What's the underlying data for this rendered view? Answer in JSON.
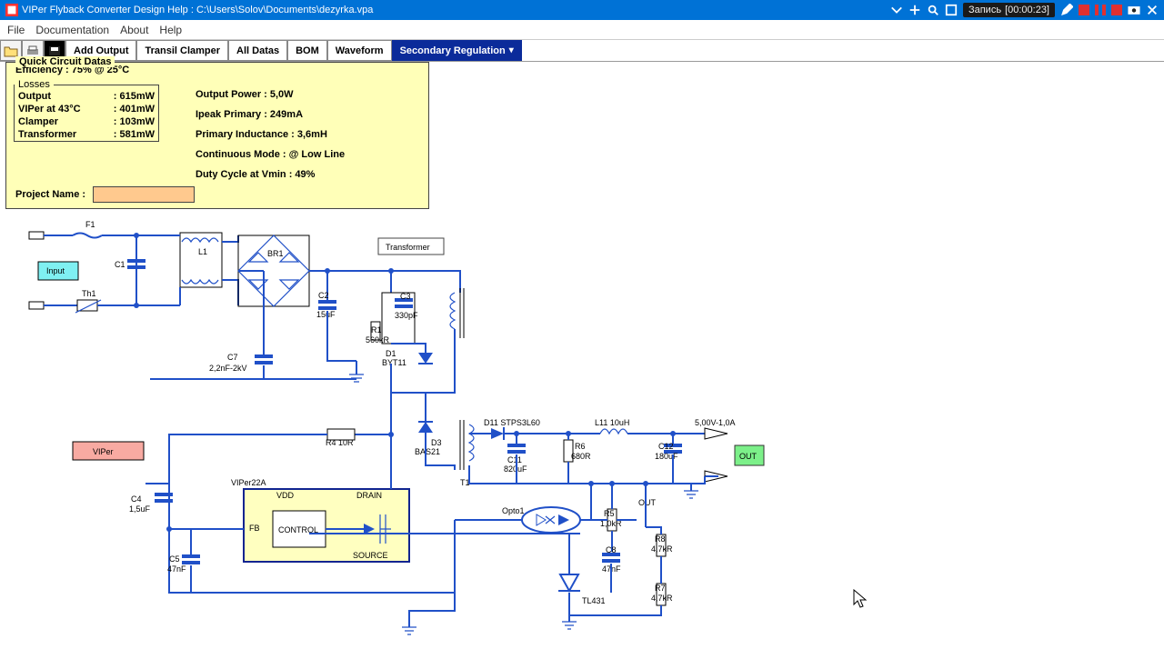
{
  "window": {
    "title": "VIPer Flyback Converter Design Help :  C:\\Users\\Solov\\Documents\\dezyrka.vpa"
  },
  "recorder": {
    "label": "Запись",
    "time": "[00:00:23]"
  },
  "menu": {
    "file": "File",
    "doc": "Documentation",
    "about": "About",
    "help": "Help"
  },
  "toolbar": {
    "add_output": "Add Output",
    "transil": "Transil Clamper",
    "all_datas": "All Datas",
    "bom": "BOM",
    "waveform": "Waveform",
    "secondary_reg": "Secondary Regulation"
  },
  "panel": {
    "title": "Quick Circuit Datas",
    "efficiency": "Efficiency : 75% @ 25°C",
    "losses_title": "Losses",
    "losses": {
      "output_k": "Output",
      "output_v": ": 615mW",
      "viper_k": "VIPer at 43°C",
      "viper_v": ": 401mW",
      "clamper_k": "Clamper",
      "clamper_v": ": 103mW",
      "trans_k": "Transformer",
      "trans_v": ": 581mW"
    },
    "right": {
      "op": "Output Power : 5,0W",
      "ip": "Ipeak Primary : 249mA",
      "pi": "Primary Inductance : 3,6mH",
      "cm": "Continuous Mode : @ Low Line",
      "dc": "Duty Cycle at Vmin : 49%"
    },
    "project_name_label": "Project Name :"
  },
  "schematic": {
    "input_btn": "Input",
    "viper_btn": "VIPer",
    "out_btn": "OUT",
    "transformer_btn": "Transformer",
    "output_spec": "5,00V-1,0A",
    "labels": {
      "F1": "F1",
      "L1": "L1",
      "BR1": "BR1",
      "C1": "C1",
      "Th1": "Th1",
      "C2": "C2",
      "C2v": "15uF",
      "C3": "C3",
      "C3v": "330pF",
      "R1": "R1",
      "R1v": "560kR",
      "D1": "D1",
      "D1v": "BYT11",
      "C7": "C7",
      "C7v": "2,2nF-2kV",
      "R4": "R4 10R",
      "D3": "D3",
      "D3v": "BAS21",
      "T1": "T1",
      "D11": "D11   STPS3L60",
      "L11": "L11  10uH",
      "C11": "C11",
      "C11v": "820uF",
      "R6": "R6",
      "R6v": "680R",
      "C12": "C12",
      "C12v": "180uF",
      "Opto1": "Opto1",
      "R5": "R5",
      "R5v": "1,0kR",
      "R8": "R8",
      "R8v": "4,7kR",
      "C8": "C8",
      "C8v": "47nF",
      "R7": "R7",
      "R7v": "4,7kR",
      "TL431": "TL431",
      "OUT": "OUT",
      "viper22a": "VIPer22A",
      "C4": "C4",
      "C4v": "1,5uF",
      "C5": "C5",
      "C5v": "47nF",
      "VDD": "VDD",
      "DRAIN": "DRAIN",
      "FB": "FB",
      "SOURCE": "SOURCE",
      "CONTROL": "CONTROL"
    }
  }
}
